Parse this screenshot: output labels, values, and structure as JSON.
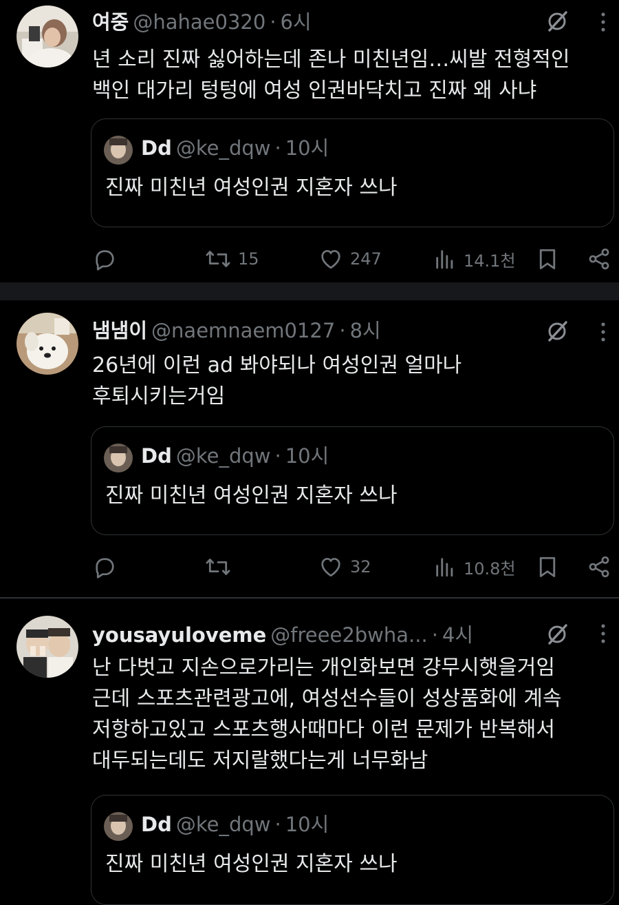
{
  "tweets": [
    {
      "name": "여중",
      "handle": "@hahae0320",
      "dot": "·",
      "time": "6시",
      "lines": [
        "년 소리 진짜 싫어하는데 존나 미친년임…씨발 전형적인",
        "백인 대가리 텅텅에 여성 인권바닥치고 진짜 왜 사냐"
      ],
      "quote": {
        "name": "Dd",
        "handle": "@ke_dqw",
        "dot": "·",
        "time": "10시",
        "text": "진짜 미친년 여성인권 지혼자 쓰나"
      },
      "retweets": "15",
      "likes": "247",
      "views": "14.1천"
    },
    {
      "name": "냄냄이",
      "handle": "@naemnaem0127",
      "dot": "·",
      "time": "8시",
      "lines": [
        "26년에 이런 ad 봐야되나 여성인권 얼마나",
        "후퇴시키는거임"
      ],
      "quote": {
        "name": "Dd",
        "handle": "@ke_dqw",
        "dot": "·",
        "time": "10시",
        "text": "진짜 미친년 여성인권 지혼자 쓰나"
      },
      "retweets": "",
      "likes": "32",
      "views": "10.8천"
    },
    {
      "name": "yousayuloveme",
      "handle": "@freee2bwha...",
      "dot": "·",
      "time": "4시",
      "lines": [
        "난 다벗고 지손으로가리는 개인화보면 걍무시햇을거임",
        "근데 스포츠관련광고에, 여성선수들이 성상품화에 계속",
        "저항하고있고 스포츠행사때마다 이런 문제가 반복해서",
        "대두되는데도 저지랄했다는게 너무화남"
      ],
      "quote": {
        "name": "Dd",
        "handle": "@ke_dqw",
        "dot": "·",
        "time": "10시",
        "text": "진짜 미친년 여성인권 지혼자 쓰나"
      }
    }
  ],
  "icons": {
    "reply": "reply-icon",
    "retweet": "retweet-icon",
    "like": "heart-icon",
    "views": "bar-chart-icon",
    "bookmark": "bookmark-icon",
    "share": "share-icon",
    "grok": "grok-icon",
    "more": "more-icon"
  },
  "colors": {
    "background": "#000000",
    "text": "#e7e9ea",
    "muted": "#71767b",
    "border": "#2f3336",
    "divider": "#16181c"
  }
}
